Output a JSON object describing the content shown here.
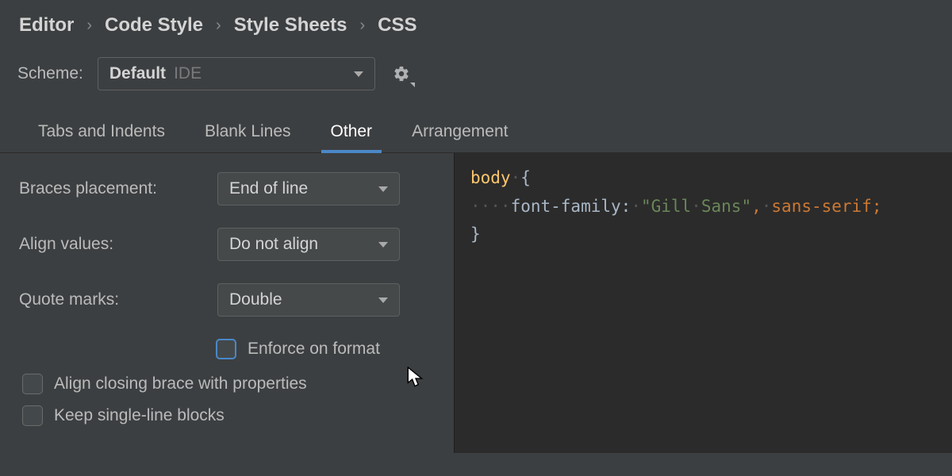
{
  "breadcrumb": [
    "Editor",
    "Code Style",
    "Style Sheets",
    "CSS"
  ],
  "scheme": {
    "label": "Scheme:",
    "name": "Default",
    "type": "IDE"
  },
  "tabs": [
    {
      "label": "Tabs and Indents",
      "active": false
    },
    {
      "label": "Blank Lines",
      "active": false
    },
    {
      "label": "Other",
      "active": true
    },
    {
      "label": "Arrangement",
      "active": false
    }
  ],
  "form": {
    "braces_label": "Braces placement:",
    "braces_value": "End of line",
    "align_label": "Align values:",
    "align_value": "Do not align",
    "quote_label": "Quote marks:",
    "quote_value": "Double",
    "enforce_label": "Enforce on format",
    "align_close_label": "Align closing brace with properties",
    "keep_single_label": "Keep single-line blocks"
  },
  "code": {
    "selector": "body",
    "ws1": "·",
    "open": "{",
    "indent": "····",
    "prop": "font-family",
    "colon": ":",
    "ws2": "·",
    "str_open": "\"",
    "str1": "Gill",
    "wsmid": "·",
    "str2": "Sans",
    "str_close": "\"",
    "comma": ",",
    "ws3": "·",
    "val": "sans-serif",
    "semi": ";",
    "close": "}"
  }
}
